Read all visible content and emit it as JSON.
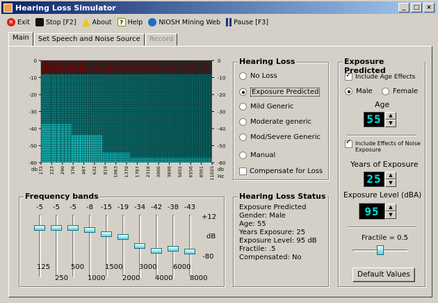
{
  "window": {
    "title": "Hearing Loss Simulator",
    "min": "_",
    "max": "□",
    "close": "×"
  },
  "menu": [
    {
      "label": "Exit",
      "icon": "exit-icon"
    },
    {
      "label": "Stop [F2]",
      "icon": "stop-icon"
    },
    {
      "label": "About",
      "icon": "about-icon"
    },
    {
      "label": "Help",
      "icon": "help-icon"
    },
    {
      "label": "NIOSH Mining Web",
      "icon": "web-icon"
    },
    {
      "label": "Pause [F3]",
      "icon": "pause-icon"
    }
  ],
  "tabs": [
    "Main",
    "Set Speech and Noise Source",
    "Record"
  ],
  "chart_data": {
    "type": "heatmap",
    "y_ticks": [
      "0",
      "-10",
      "-20",
      "-30",
      "-40",
      "-50",
      "-60"
    ],
    "y_unit": "db",
    "x_ticks": [
      "172",
      "223",
      "290",
      "376",
      "487",
      "632",
      "819",
      "1063",
      "1378",
      "1787",
      "2318",
      "3006",
      "3898",
      "5055",
      "6556",
      "8501",
      "11025"
    ],
    "x_unit": "Hz",
    "ylim": [
      -60,
      0
    ]
  },
  "hearing_loss": {
    "title": "Hearing Loss",
    "options": [
      "No Loss",
      "Exposure Predicted",
      "Mild Generic",
      "Moderate generic",
      "Mod/Severe Generic",
      "Manual"
    ],
    "selected": 1,
    "compensate": "Compensate for Loss"
  },
  "status": {
    "title": "Hearing Loss Status",
    "lines": [
      "Exposure Predicted",
      "Gender: Male",
      "Age: 55",
      "Years Exposure: 25",
      "Exposure Level: 95 dB",
      "Fractile: .5",
      "Compensated: No"
    ]
  },
  "exposure": {
    "title": "Exposure Predicted",
    "include_age": "Include Age Effects",
    "male": "Male",
    "female": "Female",
    "age_label": "Age",
    "age": "55",
    "include_noise": "Include Effects of Noise Exposure",
    "years_label": "Years of Exposure",
    "years": "25",
    "level_label": "Exposure Level (dBA)",
    "level": "95",
    "fractile_label": "Fractile = 0.5",
    "fractile": 0.5,
    "default_btn": "Default Values"
  },
  "freq": {
    "title": "Frequency bands",
    "values": [
      "-5",
      "-5",
      "-5",
      "-8",
      "-15",
      "-19",
      "-34",
      "-42",
      "-38",
      "-43"
    ],
    "plus12": "+12",
    "db": "dB",
    "minus80": "-80",
    "labels_top": [
      "125",
      "500",
      "1500",
      "3000",
      "6000"
    ],
    "labels_bot": [
      "250",
      "1000",
      "2000",
      "4000",
      "8000"
    ]
  }
}
